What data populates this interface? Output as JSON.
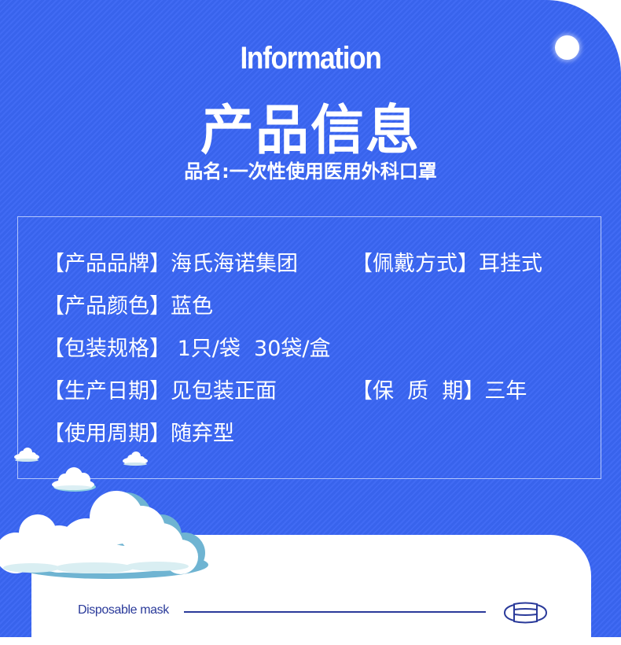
{
  "header": {
    "title_en": "Information",
    "title_cn": "产品信息",
    "product_name": "品名:一次性使用医用外科口罩"
  },
  "info": {
    "rows": [
      {
        "label": "【产品品牌】",
        "value": "海氏海诺集团"
      },
      {
        "label": "【产品颜色】",
        "value": "蓝色"
      },
      {
        "label": "【包装规格】",
        "value": " 1只/袋  30袋/盒"
      },
      {
        "label": "【生产日期】",
        "value": "见包装正面"
      },
      {
        "label": "【使用周期】",
        "value": "随弃型"
      }
    ],
    "right_column": [
      {
        "label": "【佩戴方式】",
        "value": "耳挂式"
      },
      {
        "label": "【保  质  期】",
        "value": "三年"
      }
    ]
  },
  "footer_card": {
    "label": "Disposable mask",
    "icon": "mask-icon"
  },
  "colors": {
    "background_blue": "#3a66f4",
    "card_text": "#2a3a9a",
    "cloud_shadow": "#7cbfd8"
  }
}
